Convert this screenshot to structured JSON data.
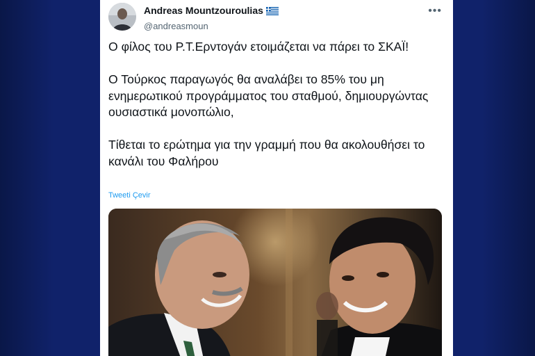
{
  "tweet": {
    "display_name": "Andreas Mountzouroulias",
    "handle": "@andreasmoun",
    "more_label": "•••",
    "paragraphs": [
      "Ο φίλος του Ρ.Τ.Ερντογάν ετοιμάζεται να πάρει το ΣΚΑΪ!",
      "Ο Τούρκος παραγωγός θα αναλάβει το 85% του μη ενημερωτικού προγράμματος του σταθμού, δημιουργώντας ουσιαστικά μονοπώλιο,",
      "Τίθεται το ερώτημα για την γραμμή που θα ακολουθήσει το κανάλι του Φαλήρου"
    ],
    "translate_label": "Tweeti Çevir"
  },
  "icons": {
    "verified_flag": "greece-flag-icon",
    "menu": "more-options-icon"
  },
  "colors": {
    "background": "#10226a",
    "link": "#1d9bf0",
    "text": "#0f1419",
    "muted": "#536471"
  }
}
